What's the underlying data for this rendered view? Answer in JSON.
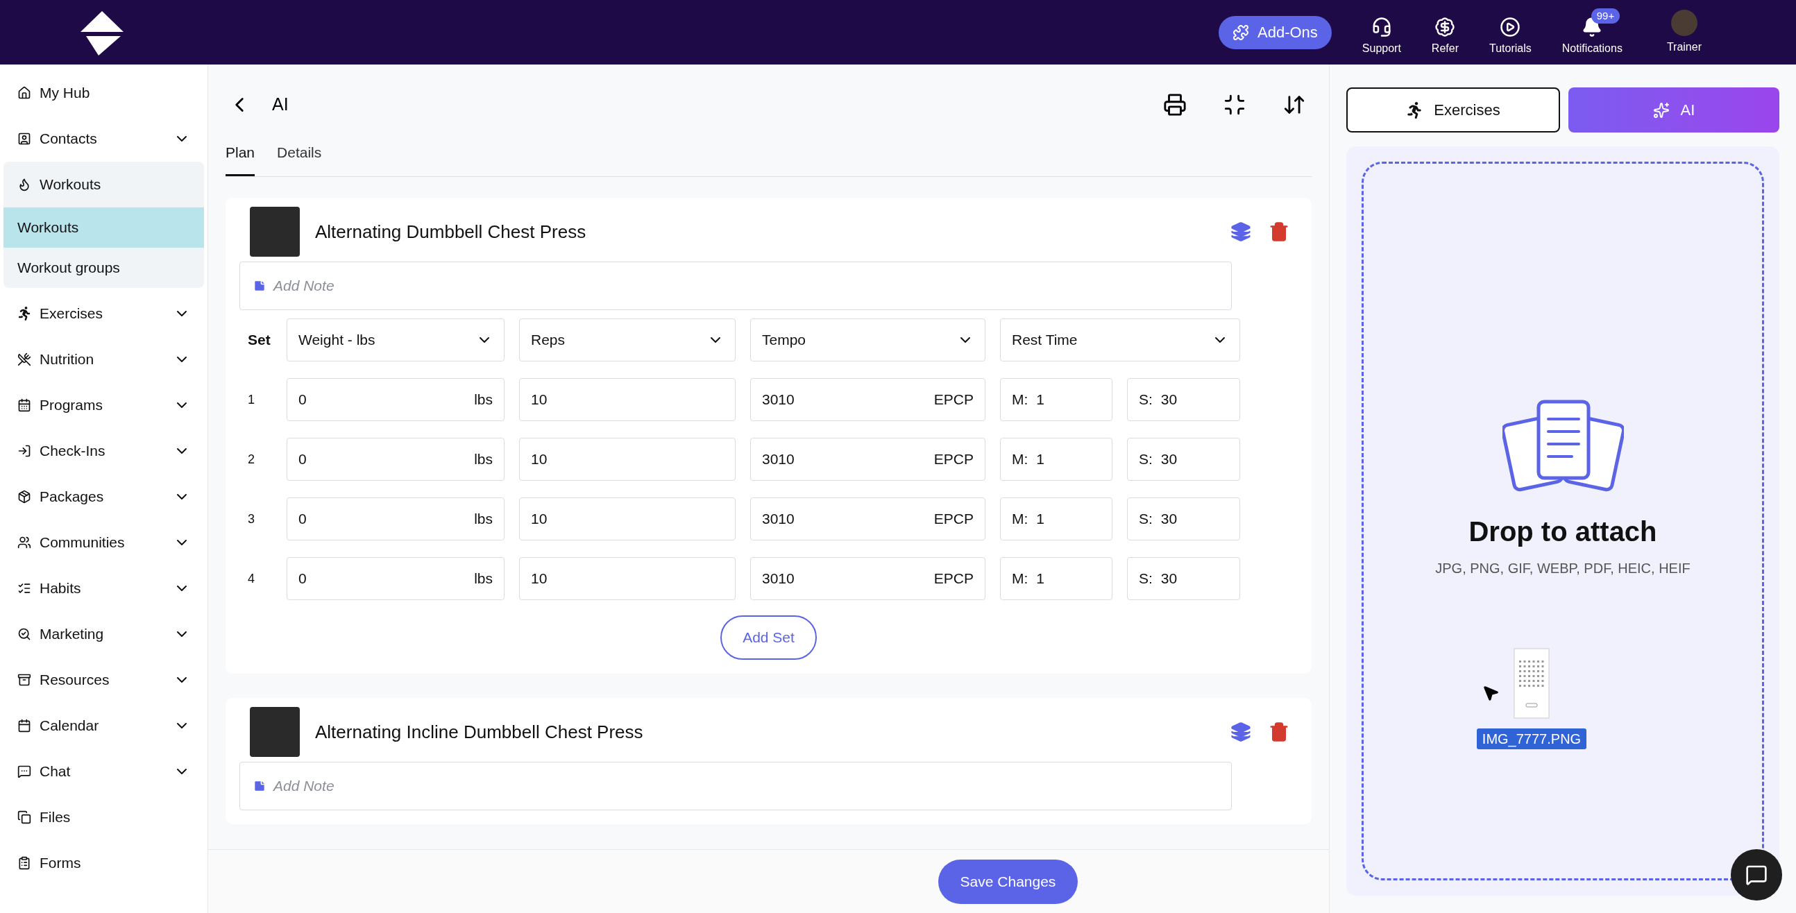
{
  "topbar": {
    "addons_button": "Add-Ons",
    "nav": [
      {
        "label": "Support"
      },
      {
        "label": "Refer"
      },
      {
        "label": "Tutorials"
      },
      {
        "label": "Notifications",
        "badge": "99+"
      }
    ],
    "profile": {
      "label": "Trainer"
    }
  },
  "sidebar": {
    "items": [
      {
        "label": "My Hub",
        "kind": "link"
      },
      {
        "label": "Contacts",
        "kind": "menu",
        "expanded": false
      },
      {
        "label": "Workouts",
        "kind": "menu",
        "expanded": true,
        "children": [
          {
            "label": "Workouts",
            "selected": true
          },
          {
            "label": "Workout groups",
            "selected": false
          }
        ]
      },
      {
        "label": "Exercises",
        "kind": "menu",
        "expanded": false
      },
      {
        "label": "Nutrition",
        "kind": "menu",
        "expanded": false
      },
      {
        "label": "Programs",
        "kind": "menu",
        "expanded": false
      },
      {
        "label": "Check-Ins",
        "kind": "menu",
        "expanded": false
      },
      {
        "label": "Packages",
        "kind": "menu",
        "expanded": false
      },
      {
        "label": "Communities",
        "kind": "menu",
        "expanded": false
      },
      {
        "label": "Habits",
        "kind": "menu",
        "expanded": false
      },
      {
        "label": "Marketing",
        "kind": "menu",
        "expanded": false
      },
      {
        "label": "Resources",
        "kind": "menu",
        "expanded": false
      },
      {
        "label": "Calendar",
        "kind": "menu",
        "expanded": false
      },
      {
        "label": "Chat",
        "kind": "menu",
        "expanded": false
      },
      {
        "label": "Files",
        "kind": "link"
      },
      {
        "label": "Forms",
        "kind": "link"
      }
    ]
  },
  "main": {
    "title": "AI",
    "tabs": [
      {
        "label": "Plan",
        "selected": true
      },
      {
        "label": "Details",
        "selected": false
      }
    ],
    "exercises": [
      {
        "title": "Alternating Dumbbell Chest Press",
        "note_placeholder": "Add Note",
        "set_header": "Set",
        "columns": [
          "Weight - lbs",
          "Reps",
          "Tempo",
          "Rest Time"
        ],
        "sets": [
          {
            "number": "1",
            "weight": "0",
            "weight_unit": "lbs",
            "reps": "10",
            "tempo": "3010",
            "tempo_tag": "EPCP",
            "min_label": "M:",
            "min": "1",
            "sec_label": "S:",
            "sec": "30"
          },
          {
            "number": "2",
            "weight": "0",
            "weight_unit": "lbs",
            "reps": "10",
            "tempo": "3010",
            "tempo_tag": "EPCP",
            "min_label": "M:",
            "min": "1",
            "sec_label": "S:",
            "sec": "30"
          },
          {
            "number": "3",
            "weight": "0",
            "weight_unit": "lbs",
            "reps": "10",
            "tempo": "3010",
            "tempo_tag": "EPCP",
            "min_label": "M:",
            "min": "1",
            "sec_label": "S:",
            "sec": "30"
          },
          {
            "number": "4",
            "weight": "0",
            "weight_unit": "lbs",
            "reps": "10",
            "tempo": "3010",
            "tempo_tag": "EPCP",
            "min_label": "M:",
            "min": "1",
            "sec_label": "S:",
            "sec": "30"
          }
        ],
        "add_set": "Add Set"
      },
      {
        "title": "Alternating Incline Dumbbell Chest Press",
        "note_placeholder": "Add Note"
      }
    ],
    "save_button": "Save Changes"
  },
  "panel": {
    "tabs": [
      {
        "label": "Exercises",
        "selected": false
      },
      {
        "label": "AI",
        "selected": true
      }
    ],
    "drop_zone": {
      "title": "Drop to attach",
      "formats": "JPG, PNG, GIF, WEBP, PDF, HEIC, HEIF",
      "dragged_file": "IMG_7777.PNG"
    }
  }
}
